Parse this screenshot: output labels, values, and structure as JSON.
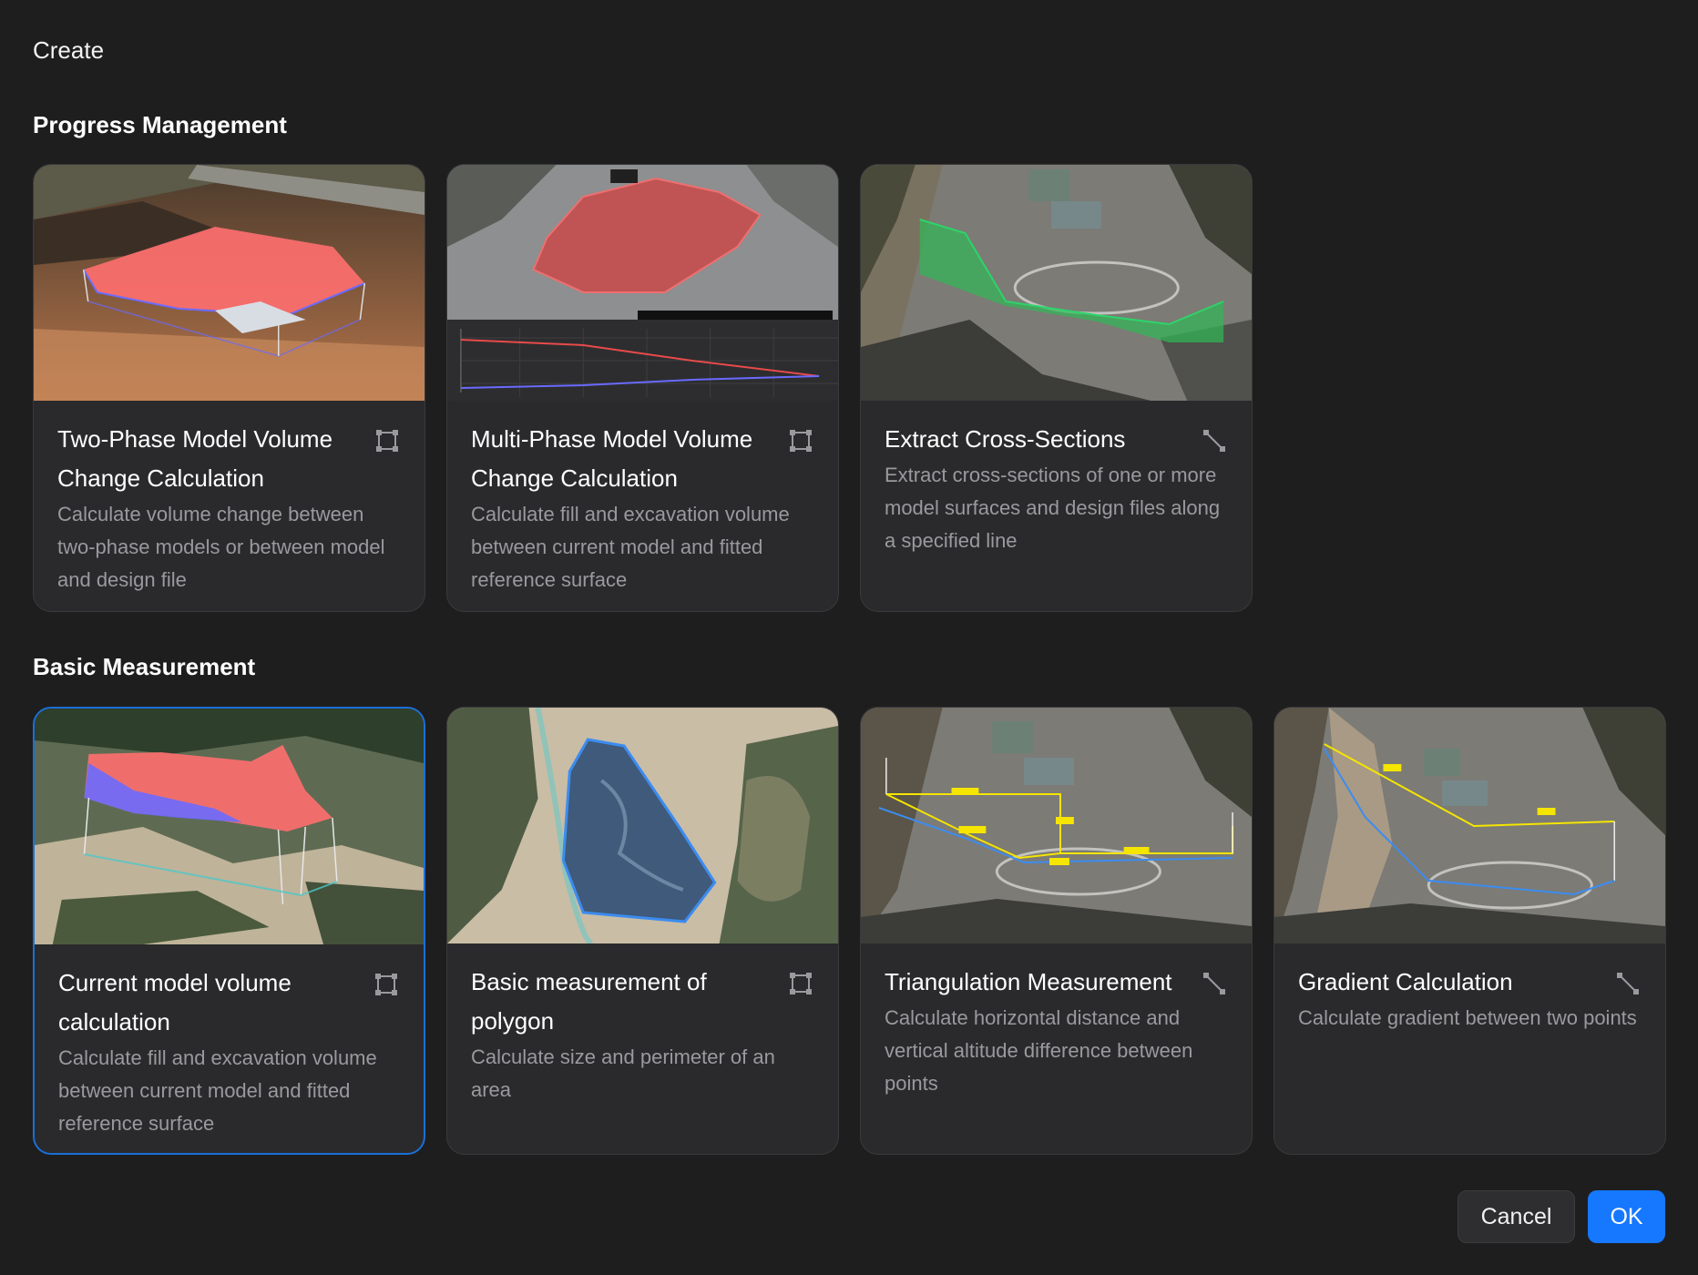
{
  "dialog": {
    "title": "Create"
  },
  "sections": [
    {
      "title": "Progress Management",
      "cards": [
        {
          "title": "Two-Phase Model Volume Change Calculation",
          "description": "Calculate volume change between two-phase models or between model and design file",
          "icon": "polygon-icon"
        },
        {
          "title": "Multi-Phase Model Volume Change Calculation",
          "description": "Calculate fill and excavation volume between current model and fitted reference surface",
          "icon": "polygon-icon"
        },
        {
          "title": "Extract Cross-Sections",
          "description": "Extract cross-sections of one or more model surfaces and design files along a specified line",
          "icon": "line-icon"
        }
      ]
    },
    {
      "title": "Basic Measurement",
      "cards": [
        {
          "title": "Current model volume calculation",
          "description": "Calculate fill and excavation volume between current model and fitted reference surface",
          "icon": "polygon-icon",
          "selected": true
        },
        {
          "title": "Basic measurement of polygon",
          "description": "Calculate size and perimeter of an area",
          "icon": "polygon-icon"
        },
        {
          "title": "Triangulation Measurement",
          "description": "Calculate horizontal distance and vertical altitude difference between points",
          "icon": "line-icon"
        },
        {
          "title": "Gradient Calculation",
          "description": "Calculate gradient between two points",
          "icon": "line-icon"
        }
      ]
    }
  ],
  "footer": {
    "cancel_label": "Cancel",
    "ok_label": "OK"
  },
  "colors": {
    "accent": "#1677ff",
    "selected_border": "#1a6fd8",
    "card_bg": "#2a2a2c",
    "dialog_bg": "#1e1e1f"
  }
}
